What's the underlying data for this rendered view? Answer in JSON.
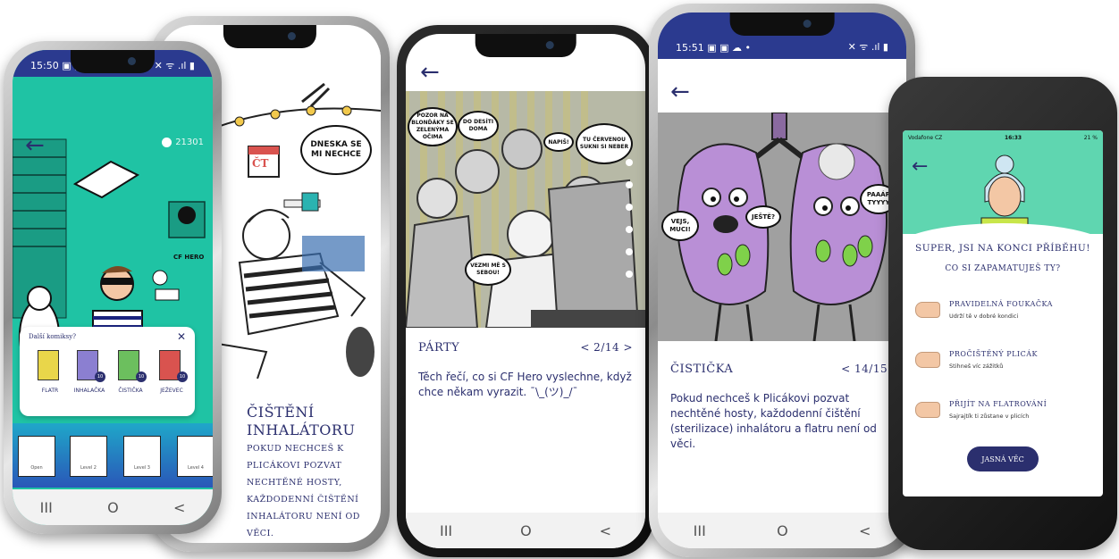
{
  "phone1": {
    "status_time": "15:50",
    "status_icons_left": "▣ ▣ ☁ •",
    "status_icons_right": "✕ ᯤ .ıl ▮",
    "coins": "21301",
    "sign_text": "CF HERO",
    "popup_title": "Další komiksy?",
    "popup_close": "✕",
    "comics": [
      {
        "label": "Flatr",
        "badge": "",
        "color": "#e9d64a"
      },
      {
        "label": "Inhalačka",
        "badge": "10",
        "color": "#8b7fd1"
      },
      {
        "label": "Čistička",
        "badge": "10",
        "color": "#6cbf5e"
      },
      {
        "label": "Ježevec",
        "badge": "10",
        "color": "#d9534f"
      }
    ],
    "boxes": [
      "Open",
      "Level 2",
      "Level 3",
      "Level 4"
    ],
    "nav": [
      "III",
      "O",
      "<"
    ]
  },
  "phone2": {
    "bubble": "DNESKA SE MI NECHCE",
    "calendar": "ČT",
    "title": "Čištění inhalátoru",
    "text": "Pokud nechceš k Plicákovi pozvat nechtěné hosty, každodenní čištění inhalátoru není od věci."
  },
  "phone3": {
    "bubbles": [
      "POZOR NA BLONĎÁKY SE ZELENÝMA OČIMA",
      "DO DESÍTI DOMA",
      "NAPIŠ!",
      "TU ČERVENOU SUKNI SI NEBER",
      "VEZMI MĚ S SEBOU!"
    ],
    "title": "Párty",
    "pager": "< 2/14 >",
    "text": "Těch řečí, co si CF Hero vyslechne, když chce někam vyrazit. ¯\\_(ツ)_/¯",
    "nav": [
      "III",
      "O",
      "<"
    ]
  },
  "phone4": {
    "status_time": "15:51",
    "status_icons_left": "▣ ▣ ☁ •",
    "status_icons_right": "✕ ᯤ .ıl ▮",
    "bubbles": [
      "VEJS, MUCI!",
      "JEŠTĚ?",
      "PAAÁR TYYYY"
    ],
    "title": "Čistička",
    "pager": "< 14/15 >",
    "text": "Pokud nechceš k Plicákovi pozvat nechtěné hosty, každodenní čištění (sterilizace) inhalátoru a flatru není od věci.",
    "nav": [
      "III",
      "O",
      "<"
    ]
  },
  "phone5": {
    "carrier": "Vodafone CZ",
    "time": "16:33",
    "battery": "21 %",
    "headline": "Super, jsi na konci příběhu!",
    "subheadline": "Co si zapamatuješ ty?",
    "items": [
      {
        "title": "Pravidelná foukačka",
        "desc": "Udrží tě v dobré kondici"
      },
      {
        "title": "Pročištěný Plicák",
        "desc": "Stihneš víc zážitků"
      },
      {
        "title": "Přijít na flatrování",
        "desc": "Sajrajtík ti zůstane v plicích"
      }
    ],
    "button": "Jasná věc"
  },
  "colors": {
    "navy": "#2b2f6e",
    "teal": "#22c5a6",
    "lung_purple": "#b98fd6",
    "status_blue": "#2b3a8f"
  }
}
